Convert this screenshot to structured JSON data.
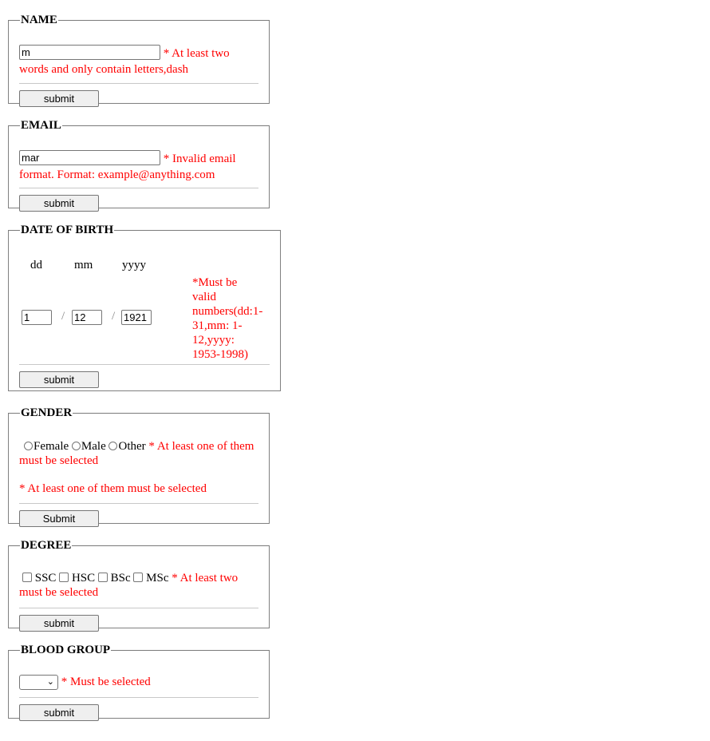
{
  "name_section": {
    "legend": "NAME",
    "input_value": "m",
    "error": "* At least two words and only contain letters,dash",
    "submit_label": "submit"
  },
  "email_section": {
    "legend": "EMAIL",
    "input_value": "mar",
    "error": "* Invalid email format. Format: example@anything.com",
    "submit_label": "submit"
  },
  "dob_section": {
    "legend": "DATE OF BIRTH",
    "dd_label": "dd",
    "mm_label": "mm",
    "yyyy_label": "yyyy",
    "dd_value": "1",
    "mm_value": "12",
    "yyyy_value": "1921",
    "separator": "/",
    "error_lines": [
      "*Must be",
      "valid",
      "numbers(dd:1-",
      "31,mm: 1-",
      "12,yyyy:",
      "1953-1998)"
    ],
    "submit_label": "submit"
  },
  "gender_section": {
    "legend": "GENDER",
    "options": [
      "Female",
      "Male",
      "Other"
    ],
    "error_inline": "* At least one of them must be selected",
    "error_block": "* At least one of them must be selected",
    "submit_label": "Submit"
  },
  "degree_section": {
    "legend": "DEGREE",
    "options": [
      "SSC",
      "HSC",
      "BSc",
      "MSc"
    ],
    "error": "* At least two must be selected",
    "submit_label": "submit"
  },
  "blood_section": {
    "legend": "BLOOD GROUP",
    "selected_value": "",
    "error": "* Must be selected",
    "submit_label": "submit"
  },
  "colors": {
    "error": "#ff0000",
    "border": "#808080"
  },
  "icons": {
    "dropdown": "chevron-down-icon"
  }
}
